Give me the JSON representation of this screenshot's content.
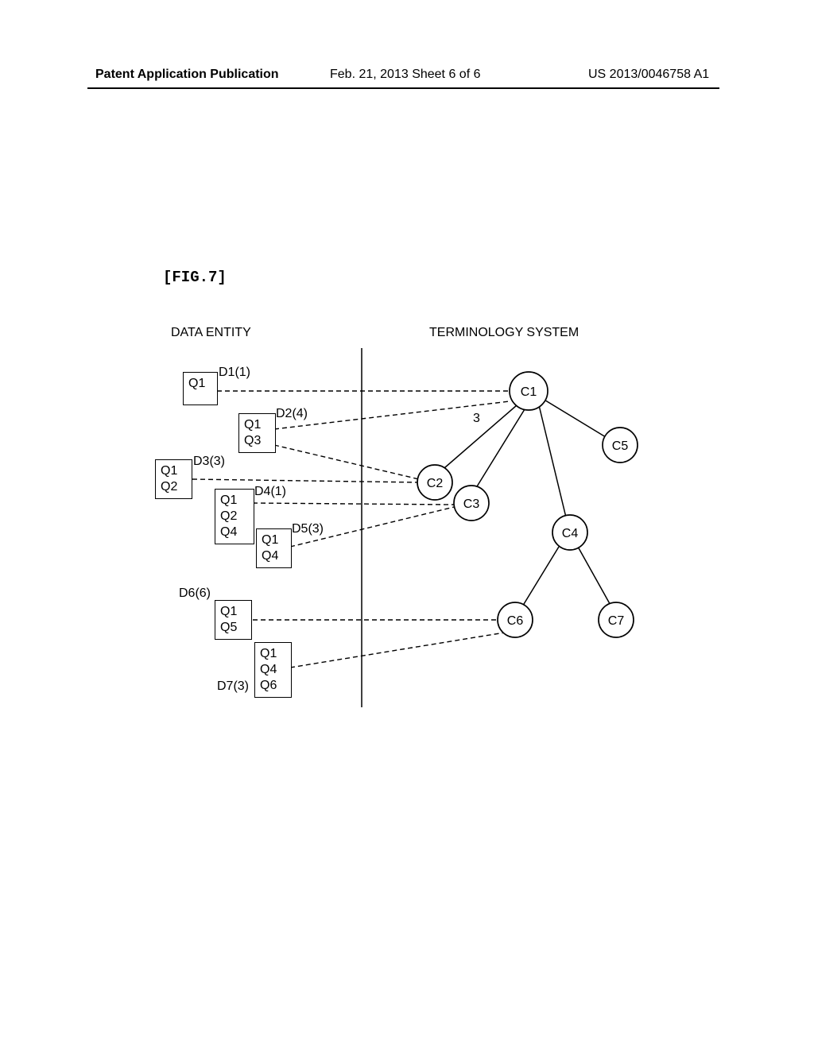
{
  "header": {
    "left": "Patent Application Publication",
    "mid": "Feb. 21, 2013  Sheet 6 of 6",
    "right": "US 2013/0046758 A1"
  },
  "figure_label": "[FIG.7]",
  "section_labels": {
    "left": "DATA ENTITY",
    "right": "TERMINOLOGY SYSTEM"
  },
  "edge_label": "3",
  "entities": {
    "d1": {
      "label": "D1(1)",
      "items": "Q1"
    },
    "d2": {
      "label": "D2(4)",
      "items": "Q1\nQ3"
    },
    "d3": {
      "label": "D3(3)",
      "items": "Q1\nQ2"
    },
    "d4": {
      "label": "D4(1)",
      "items": "Q1\nQ2\nQ4"
    },
    "d5": {
      "label": "D5(3)",
      "items": "Q1\nQ4"
    },
    "d6": {
      "label": "D6(6)",
      "items": "Q1\nQ5"
    },
    "d7": {
      "label": "D7(3)",
      "items": "Q1\nQ4\nQ6"
    }
  },
  "concepts": {
    "c1": "C1",
    "c2": "C2",
    "c3": "C3",
    "c4": "C4",
    "c5": "C5",
    "c6": "C6",
    "c7": "C7"
  }
}
